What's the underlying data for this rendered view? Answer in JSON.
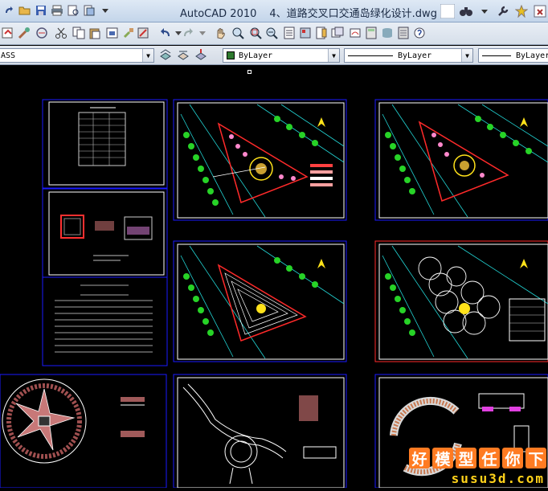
{
  "window": {
    "app_name": "AutoCAD 2010",
    "file_prefix": "4、",
    "file_name": "道路交叉口交通岛绿化设计.dwg"
  },
  "toolbar_layers": {
    "layer_combo_value": "ASS",
    "color_combo_value": "ByLayer",
    "linetype_combo_value": "ByLayer",
    "lineweight_combo_value": "ByLayer"
  },
  "watermark": {
    "chars": [
      "好",
      "模",
      "型",
      "任",
      "你",
      "下"
    ],
    "url": "susu3d.com"
  },
  "colors": {
    "sheet_border": "#1a1aff",
    "paper_border": "#ffffff",
    "tree": "#27d327",
    "red_line": "#ff2a2a",
    "yellow": "#ffe21a",
    "cyan": "#22d6d6",
    "watermark_orange": "#ff7b22"
  }
}
